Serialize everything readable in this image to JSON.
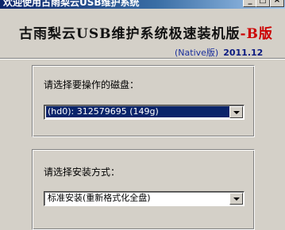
{
  "window": {
    "title": "欢迎使用古雨梨云USB维护系统"
  },
  "banner": {
    "title_main": "古雨梨云USB维护系统极速装机版",
    "title_edition": "-B版",
    "subtitle": "(Native版)",
    "version": "2011.12"
  },
  "disk_group": {
    "label": "请选择要操作的磁盘：",
    "selected_value": "(hd0): 312579695 (149g)"
  },
  "install_group": {
    "label": "请选择安装方式：",
    "selected_value": "标准安装(重新格式化全盘)"
  },
  "colors": {
    "titlebar_start": "#0a246a",
    "titlebar_end": "#a6caf0",
    "edition_red": "#cc0000",
    "subtitle_blue": "#1a2f9c",
    "selection": "#0a246a"
  }
}
